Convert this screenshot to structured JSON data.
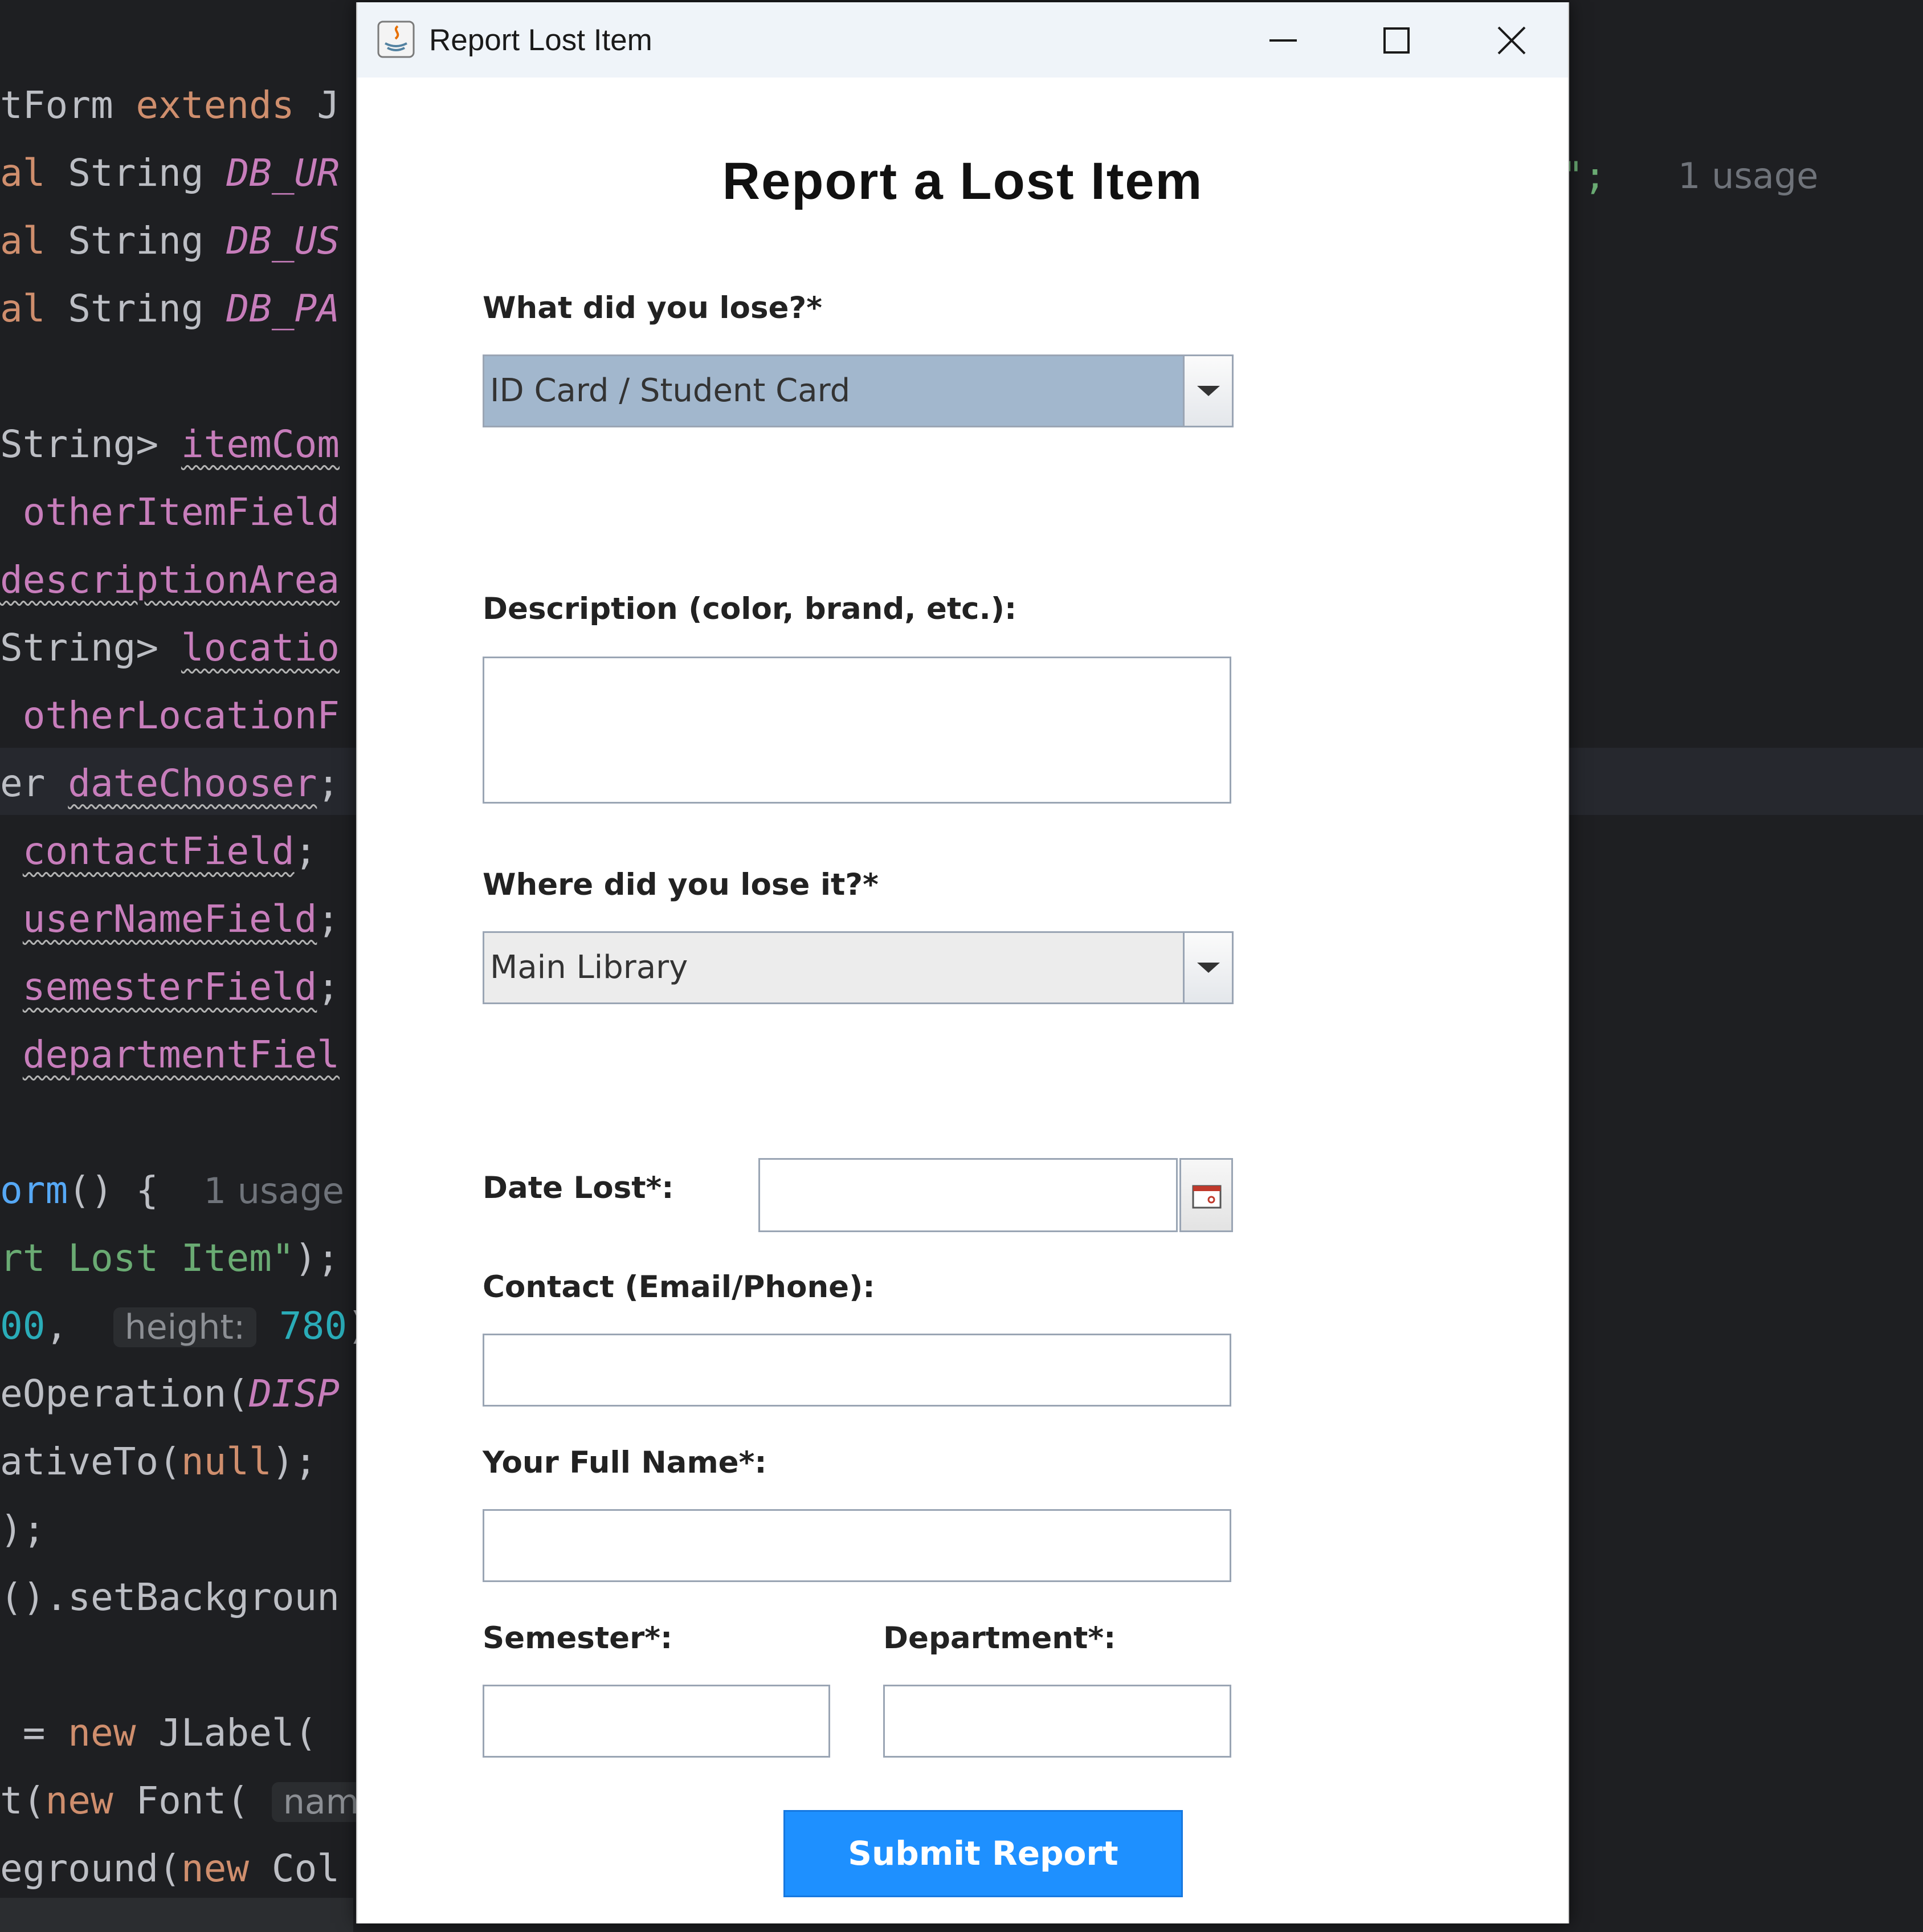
{
  "editor": {
    "lines": [
      {
        "segments": [
          {
            "t": "tForm ",
            "c": ""
          },
          {
            "t": "extends",
            "c": "kw"
          },
          {
            "t": " J",
            "c": ""
          }
        ]
      },
      {
        "segments": [
          {
            "t": "al ",
            "c": "kw"
          },
          {
            "t": "String ",
            "c": ""
          },
          {
            "t": "DB_UR",
            "c": "fld ital"
          }
        ]
      },
      {
        "segments": [
          {
            "t": "al ",
            "c": "kw"
          },
          {
            "t": "String ",
            "c": ""
          },
          {
            "t": "DB_US",
            "c": "fld ital"
          }
        ]
      },
      {
        "segments": [
          {
            "t": "al ",
            "c": "kw"
          },
          {
            "t": "String ",
            "c": ""
          },
          {
            "t": "DB_PA",
            "c": "fld ital"
          }
        ]
      },
      {
        "segments": []
      },
      {
        "segments": [
          {
            "t": "String> ",
            "c": ""
          },
          {
            "t": "itemCom",
            "c": "fld wavy"
          }
        ]
      },
      {
        "segments": [
          {
            "t": " ",
            "c": ""
          },
          {
            "t": "otherItemField",
            "c": "fld"
          }
        ]
      },
      {
        "segments": [
          {
            "t": "descriptionArea",
            "c": "fld wavy"
          }
        ]
      },
      {
        "segments": [
          {
            "t": "String> ",
            "c": ""
          },
          {
            "t": "locatio",
            "c": "fld wavy"
          }
        ]
      },
      {
        "segments": [
          {
            "t": " ",
            "c": ""
          },
          {
            "t": "otherLocationF",
            "c": "fld"
          }
        ]
      },
      {
        "segments": [
          {
            "t": "er ",
            "c": ""
          },
          {
            "t": "dateChooser",
            "c": "fld wavy"
          },
          {
            "t": ";",
            "c": ""
          }
        ]
      },
      {
        "segments": [
          {
            "t": " ",
            "c": ""
          },
          {
            "t": "contactField",
            "c": "fld wavy"
          },
          {
            "t": ";",
            "c": ""
          }
        ]
      },
      {
        "segments": [
          {
            "t": " ",
            "c": ""
          },
          {
            "t": "userNameField",
            "c": "fld wavy"
          },
          {
            "t": ";",
            "c": ""
          }
        ]
      },
      {
        "segments": [
          {
            "t": " ",
            "c": ""
          },
          {
            "t": "semesterField",
            "c": "fld wavy"
          },
          {
            "t": ";",
            "c": ""
          }
        ]
      },
      {
        "segments": [
          {
            "t": " ",
            "c": ""
          },
          {
            "t": "departmentFiel",
            "c": "fld wavy"
          }
        ]
      },
      {
        "segments": []
      },
      {
        "segments": [
          {
            "t": "orm",
            "c": "meth"
          },
          {
            "t": "() {  ",
            "c": ""
          },
          {
            "t": "1 usage",
            "c": "hint"
          }
        ]
      },
      {
        "segments": [
          {
            "t": "rt Lost Item\"",
            "c": "str"
          },
          {
            "t": ");",
            "c": ""
          }
        ]
      },
      {
        "segments": [
          {
            "t": "00",
            "c": "num"
          },
          {
            "t": ",  ",
            "c": ""
          },
          {
            "t": "height:",
            "c": "inlay"
          },
          {
            "t": " ",
            "c": ""
          },
          {
            "t": "780",
            "c": "num"
          },
          {
            "t": ")",
            "c": ""
          }
        ]
      },
      {
        "segments": [
          {
            "t": "eOperation(",
            "c": ""
          },
          {
            "t": "DISP",
            "c": "fld ital"
          }
        ]
      },
      {
        "segments": [
          {
            "t": "ativeTo(",
            "c": ""
          },
          {
            "t": "null",
            "c": "kw"
          },
          {
            "t": ");",
            "c": ""
          }
        ]
      },
      {
        "segments": [
          {
            "t": ");",
            "c": ""
          }
        ]
      },
      {
        "segments": [
          {
            "t": "().setBackgroun",
            "c": ""
          }
        ]
      },
      {
        "segments": []
      },
      {
        "segments": [
          {
            "t": " = ",
            "c": ""
          },
          {
            "t": "new",
            "c": "kw"
          },
          {
            "t": " JLabel(",
            "c": ""
          }
        ]
      },
      {
        "segments": [
          {
            "t": "t(",
            "c": ""
          },
          {
            "t": "new",
            "c": "kw"
          },
          {
            "t": " Font( ",
            "c": ""
          },
          {
            "t": "nam",
            "c": "inlay"
          }
        ]
      },
      {
        "segments": [
          {
            "t": "eground(",
            "c": ""
          },
          {
            "t": "new",
            "c": "kw"
          },
          {
            "t": " Col",
            "c": ""
          }
        ]
      }
    ],
    "right_fragment": "d\";",
    "right_usage": "1 usage"
  },
  "window": {
    "title": "Report Lost Item",
    "minimize_icon": "minimize-icon",
    "maximize_icon": "maximize-icon",
    "close_icon": "close-icon",
    "app_icon": "java-icon"
  },
  "form": {
    "title": "Report a Lost Item",
    "item_label": "What did you lose?*",
    "item_value": "ID Card / Student Card",
    "description_label": "Description (color, brand, etc.):",
    "description_value": "",
    "location_label": "Where did you lose it?*",
    "location_value": "Main Library",
    "date_label": "Date Lost*:",
    "date_value": "",
    "contact_label": "Contact (Email/Phone):",
    "contact_value": "",
    "name_label": "Your Full Name*:",
    "name_value": "",
    "semester_label": "Semester*:",
    "semester_value": "",
    "department_label": "Department*:",
    "department_value": "",
    "submit_label": "Submit Report",
    "calendar_icon": "calendar-icon",
    "dropdown_icon": "chevron-down-icon"
  },
  "colors": {
    "editor_bg": "#1e1f22",
    "keyword": "#cf8e6d",
    "field": "#c77dbb",
    "string": "#6aab73",
    "number": "#2aacb8",
    "submit_bg": "#1e90ff",
    "combo_selected": "#a2b7cd"
  }
}
